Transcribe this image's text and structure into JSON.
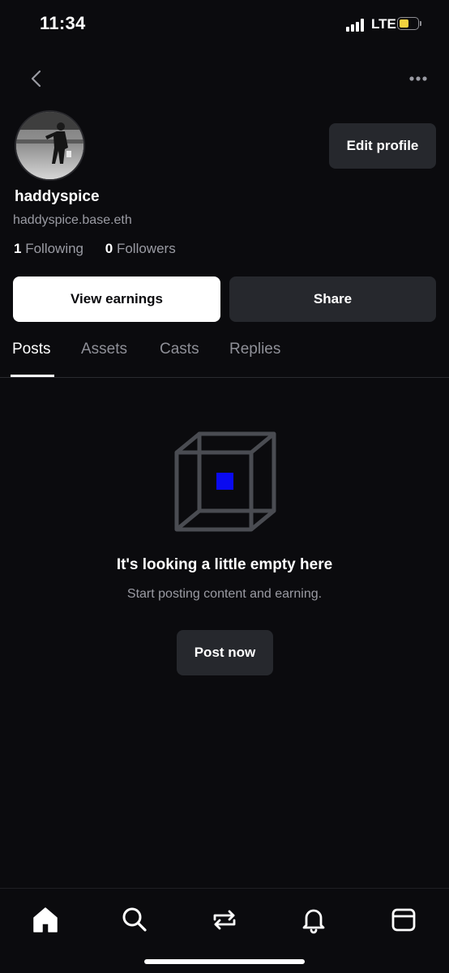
{
  "status_bar": {
    "time": "11:34",
    "network": "LTE"
  },
  "profile": {
    "username": "haddyspice",
    "ens_name": "haddyspice.base.eth",
    "following_count": "1",
    "following_label": "Following",
    "followers_count": "0",
    "followers_label": "Followers",
    "edit_profile_label": "Edit profile"
  },
  "actions": {
    "view_earnings_label": "View earnings",
    "share_label": "Share"
  },
  "tabs": [
    {
      "label": "Posts",
      "active": true
    },
    {
      "label": "Assets",
      "active": false
    },
    {
      "label": "Casts",
      "active": false
    },
    {
      "label": "Replies",
      "active": false
    }
  ],
  "empty_state": {
    "title": "It's looking a little empty here",
    "subtitle": "Start posting content and earning.",
    "button_label": "Post now"
  },
  "bottom_nav": [
    {
      "icon": "home-icon",
      "active": true
    },
    {
      "icon": "search-icon",
      "active": false
    },
    {
      "icon": "swap-icon",
      "active": false
    },
    {
      "icon": "bell-icon",
      "active": false
    },
    {
      "icon": "wallet-icon",
      "active": false
    }
  ],
  "colors": {
    "background": "#0b0b0e",
    "surface": "#26282d",
    "text_primary": "#ffffff",
    "text_secondary": "#9a9ba3",
    "accent_blue": "#0a0af0",
    "battery": "#f5d33f"
  }
}
